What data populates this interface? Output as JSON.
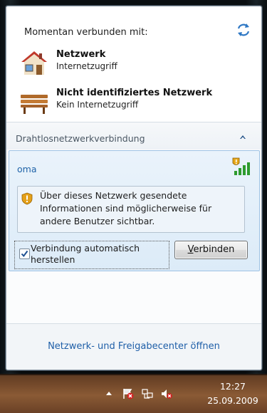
{
  "header": {
    "title": "Momentan verbunden mit:",
    "refresh_icon": "refresh-icon"
  },
  "connected_networks": [
    {
      "name": "Netzwerk",
      "status": "Internetzugriff",
      "icon": "house-network-icon"
    },
    {
      "name": "Nicht identifiziertes Netzwerk",
      "status": "Kein Internetzugriff",
      "icon": "bench-network-icon"
    }
  ],
  "wireless_section": {
    "label": "Drahtlosnetzwerkverbindung",
    "collapse_icon": "chevron-up-icon"
  },
  "wifi_network": {
    "ssid": "oma",
    "signal_icon": "wifi-signal-unsecured-icon",
    "warning": "Über dieses Netzwerk gesendete Informationen sind möglicherweise für andere Benutzer sichtbar.",
    "auto_connect_label": "Verbindung automatisch herstellen",
    "auto_connect_checked": true,
    "connect_button_access_key": "V",
    "connect_button_rest": "erbinden"
  },
  "footer": {
    "link": "Netzwerk- und Freigabecenter öffnen"
  },
  "taskbar": {
    "time": "12:27",
    "date": "25.09.2009",
    "tray_icons": [
      "show-hidden-icons-arrow-icon",
      "action-center-error-icon",
      "network-icon",
      "volume-muted-icon"
    ]
  },
  "colors": {
    "link_blue": "#1f5fa8",
    "panel_blue": "#dcebf8",
    "taskbar_brown": "#7a4e2e"
  }
}
